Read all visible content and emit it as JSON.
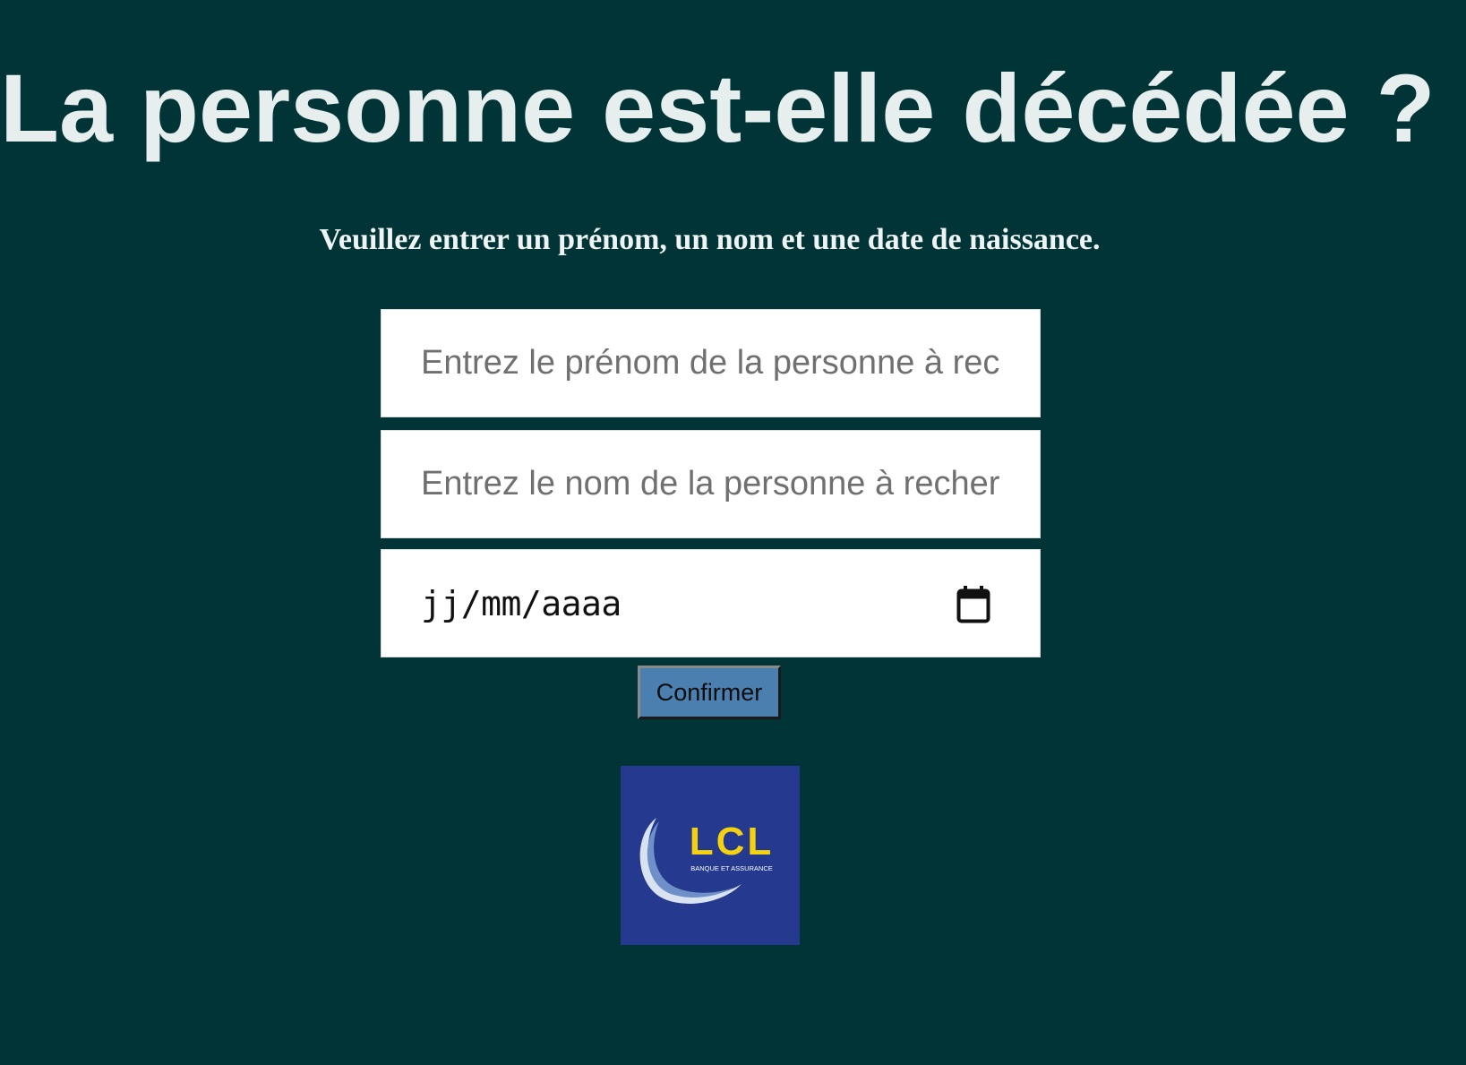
{
  "page": {
    "title": "La personne est-elle décédée ?",
    "subtitle": "Veuillez entrer un prénom, un nom et une date de naissance."
  },
  "form": {
    "first_name_placeholder": "Entrez le prénom de la personne à rechercher",
    "last_name_placeholder": "Entrez le nom de la personne à rechercher",
    "date_format_text": "jj/mm/aaaa",
    "confirm_label": "Confirmer"
  },
  "logo": {
    "brand_text": "LCL",
    "tagline": "BANQUE ET ASSURANCE",
    "icon": "lcl-logo"
  },
  "colors": {
    "background": "#003436",
    "title_text": "#e6eeee",
    "button": "#4a7fb0",
    "logo_background": "#253a8f",
    "logo_letters": "#f5d20f"
  }
}
